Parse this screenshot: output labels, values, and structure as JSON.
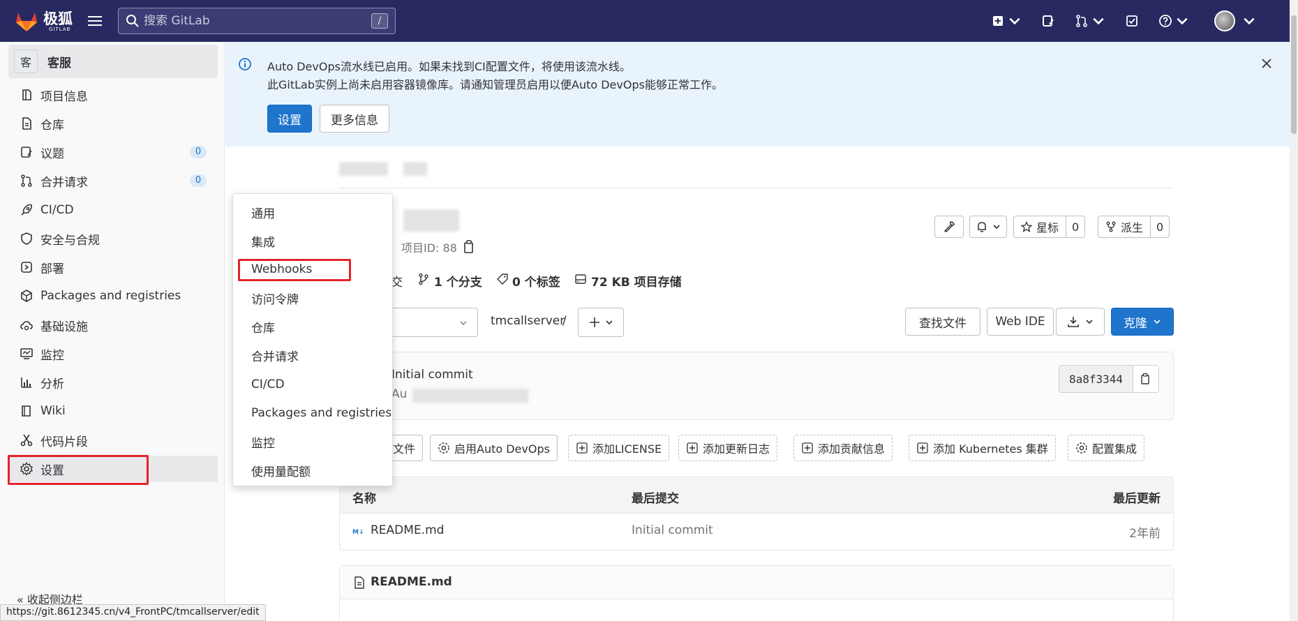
{
  "topbar": {
    "logo_text": "极狐",
    "logo_sub": "GITLAB",
    "search_placeholder": "搜索 GitLab",
    "search_shortcut": "/"
  },
  "sidebar": {
    "project_avatar": "客",
    "project_name": "客服",
    "items": [
      {
        "label": "项目信息"
      },
      {
        "label": "仓库"
      },
      {
        "label": "议题",
        "count": "0"
      },
      {
        "label": "合并请求",
        "count": "0"
      },
      {
        "label": "CI/CD"
      },
      {
        "label": "安全与合规"
      },
      {
        "label": "部署"
      },
      {
        "label": "Packages and registries"
      },
      {
        "label": "基础设施"
      },
      {
        "label": "监控"
      },
      {
        "label": "分析"
      },
      {
        "label": "Wiki"
      },
      {
        "label": "代码片段"
      },
      {
        "label": "设置"
      }
    ],
    "collapse_label": "« 收起侧边栏"
  },
  "status_url": "https://git.8612345.cn/v4_FrontPC/tmcallserver/edit",
  "alert": {
    "line1": "Auto DevOps流水线已启用。如果未找到CI配置文件，将使用该流水线。",
    "line2": "此GitLab实例上尚未启用容器镜像库。请通知管理员启用以便Auto DevOps能够正常工作。",
    "primary_button": "设置",
    "secondary_button": "更多信息"
  },
  "dropdown": {
    "items": [
      "通用",
      "集成",
      "Webhooks",
      "访问令牌",
      "仓库",
      "合并请求",
      "CI/CD",
      "Packages and registries",
      "监控",
      "使用量配额"
    ]
  },
  "project": {
    "id_label": "项目ID: 88",
    "star_label": "星标",
    "star_count": "0",
    "fork_label": "派生",
    "fork_count": "0",
    "stats": {
      "commits_suffix": "交",
      "branches": "1 个分支",
      "tags": "0 个标签",
      "storage": "72 KB 项目存储"
    },
    "path": "tmcallserver",
    "path_sep": "/",
    "find_file": "查找文件",
    "web_ide": "Web IDE",
    "clone": "克隆",
    "commit": {
      "title": "Initial commit",
      "author_prefix": "Au",
      "sha": "8a8f3344"
    },
    "actions": [
      "文件",
      "启用Auto DevOps",
      "添加LICENSE",
      "添加更新日志",
      "添加贡献信息",
      "添加 Kubernetes 集群",
      "配置集成"
    ],
    "table": {
      "headers": [
        "名称",
        "最后提交",
        "最后更新"
      ],
      "rows": [
        {
          "name": "README.md",
          "commit": "Initial commit",
          "updated": "2年前"
        }
      ]
    },
    "readme_title": "README.md"
  }
}
